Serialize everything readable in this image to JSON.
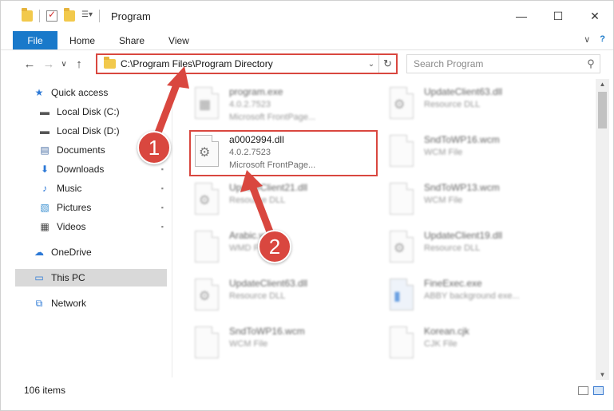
{
  "window": {
    "title": "Program",
    "controls": {
      "minimize": "—",
      "maximize": "☐",
      "close": "✕"
    }
  },
  "ribbon": {
    "file_tab": "File",
    "tabs": [
      "Home",
      "Share",
      "View"
    ]
  },
  "navigation": {
    "back": "←",
    "forward": "→",
    "recent": "∨",
    "up": "↑",
    "address": "C:\\Program Files\\Program Directory",
    "address_dropdown": "⌄",
    "refresh": "↻",
    "search_placeholder": "Search Program",
    "search_icon": "⚲"
  },
  "sidebar": {
    "items": [
      {
        "label": "Quick access",
        "icon": "star-icon",
        "glyph": "★",
        "color": "#2b78d6",
        "pinned": false
      },
      {
        "label": "Local Disk (C:)",
        "icon": "drive-icon",
        "glyph": "▬",
        "color": "#555555",
        "pinned": false
      },
      {
        "label": "Local Disk (D:)",
        "icon": "drive-icon",
        "glyph": "▬",
        "color": "#555555",
        "pinned": false
      },
      {
        "label": "Documents",
        "icon": "documents-icon",
        "glyph": "▤",
        "color": "#4a6fa5",
        "pinned": false
      },
      {
        "label": "Downloads",
        "icon": "download-icon",
        "glyph": "⬇",
        "color": "#2b78d6",
        "pinned": true
      },
      {
        "label": "Music",
        "icon": "music-icon",
        "glyph": "♪",
        "color": "#2b78d6",
        "pinned": true
      },
      {
        "label": "Pictures",
        "icon": "pictures-icon",
        "glyph": "▧",
        "color": "#3a8fd0",
        "pinned": true
      },
      {
        "label": "Videos",
        "icon": "videos-icon",
        "glyph": "▦",
        "color": "#444444",
        "pinned": true
      },
      {
        "label": "OneDrive",
        "icon": "cloud-icon",
        "glyph": "☁",
        "color": "#2b78d6",
        "pinned": false
      },
      {
        "label": "This PC",
        "icon": "computer-icon",
        "glyph": "▭",
        "color": "#2b78d6",
        "pinned": false,
        "selected": true
      },
      {
        "label": "Network",
        "icon": "network-icon",
        "glyph": "⧉",
        "color": "#2b78d6",
        "pinned": false
      }
    ],
    "pin_glyph": "📌"
  },
  "files": [
    {
      "name": "program.exe",
      "line2": "4.0.2.7523",
      "line3": "Microsoft FrontPage...",
      "blurred": true
    },
    {
      "name": "UpdateClient63.dll",
      "line2": "Resource DLL",
      "line3": "",
      "blurred": true
    },
    {
      "name": "a0002994.dll",
      "line2": "4.0.2.7523",
      "line3": "Microsoft FrontPage...",
      "blurred": false,
      "highlighted": true
    },
    {
      "name": "SndToWP16.wcm",
      "line2": "WCM File",
      "line3": "",
      "blurred": true
    },
    {
      "name": "UpdateClient21.dll",
      "line2": "Resource DLL",
      "line3": "",
      "blurred": true
    },
    {
      "name": "SndToWP13.wcm",
      "line2": "WCM File",
      "line3": "",
      "blurred": true
    },
    {
      "name": "Arabic.wmd",
      "line2": "WMD File",
      "line3": "",
      "blurred": true
    },
    {
      "name": "UpdateClient19.dll",
      "line2": "Resource DLL",
      "line3": "",
      "blurred": true
    },
    {
      "name": "UpdateClient63.dll",
      "line2": "Resource DLL",
      "line3": "",
      "blurred": true
    },
    {
      "name": "FineExec.exe",
      "line2": "ABBY background exe...",
      "line3": "",
      "blurred": true
    },
    {
      "name": "SndToWP16.wcm",
      "line2": "WCM File",
      "line3": "",
      "blurred": true
    },
    {
      "name": "Korean.cjk",
      "line2": "CJK File",
      "line3": "",
      "blurred": true
    }
  ],
  "status": {
    "item_count": "106 items"
  },
  "callouts": [
    {
      "number": "1"
    },
    {
      "number": "2"
    }
  ],
  "colors": {
    "accent": "#1979ca",
    "callout": "#d9473f"
  }
}
